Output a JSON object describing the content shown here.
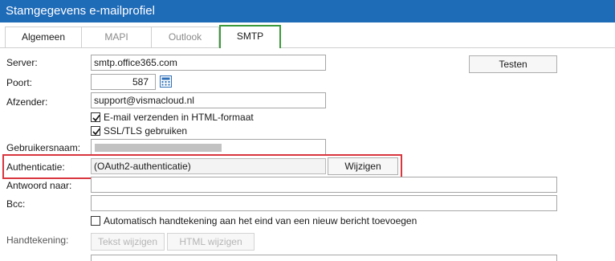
{
  "window": {
    "title": "Stamgegevens e-mailprofiel"
  },
  "tabs": [
    {
      "label": "Algemeen"
    },
    {
      "label": "MAPI"
    },
    {
      "label": "Outlook"
    },
    {
      "label": "SMTP"
    }
  ],
  "active_tab": "SMTP",
  "form": {
    "server_label": "Server:",
    "server_value": "smtp.office365.com",
    "test_button": "Testen",
    "port_label": "Poort:",
    "port_value": "587",
    "sender_label": "Afzender:",
    "sender_value": "support@vismacloud.nl",
    "html_checkbox_label": "E-mail verzenden in HTML-formaat",
    "html_checked": true,
    "ssl_checkbox_label": "SSL/TLS gebruiken",
    "ssl_checked": true,
    "username_label": "Gebruikersnaam:",
    "auth_label": "Authenticatie:",
    "auth_value": "(OAuth2-authenticatie)",
    "change_button": "Wijzigen",
    "reply_to_label": "Antwoord naar:",
    "reply_to_value": "",
    "bcc_label": "Bcc:",
    "bcc_value": "",
    "auto_signature_label": "Automatisch handtekening aan het eind van een nieuw bericht toevoegen",
    "auto_signature_checked": false,
    "signature_label": "Handtekening:",
    "edit_text_button": "Tekst wijzigen",
    "edit_html_button": "HTML wijzigen"
  },
  "colors": {
    "titlebar": "#1e6bb8",
    "active_tab_border": "#3c9a3c",
    "highlight_border": "#d9363e"
  },
  "icons": {
    "calculator": "calculator-icon",
    "check": "checkmark-icon"
  }
}
